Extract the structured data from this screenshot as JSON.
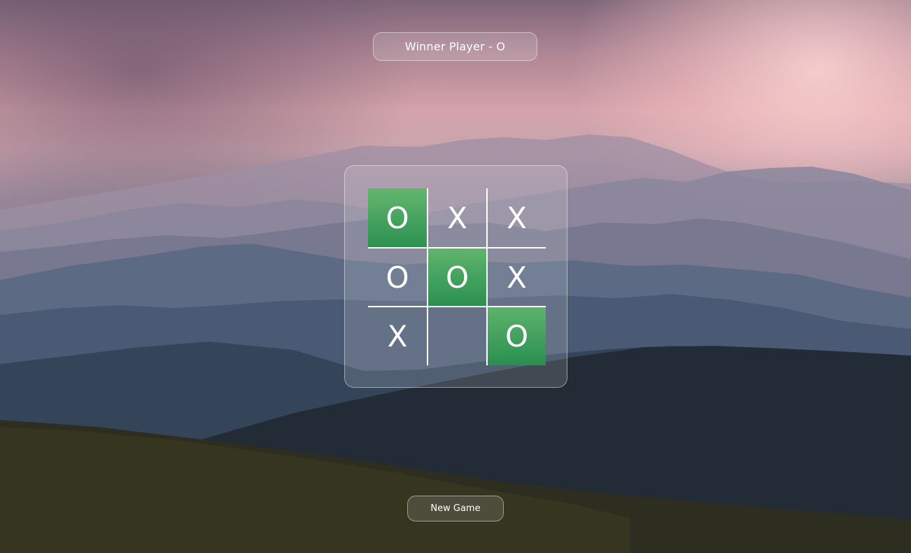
{
  "status": {
    "text": "Winner Player - O"
  },
  "board": {
    "cells": [
      {
        "mark": "O",
        "win": true
      },
      {
        "mark": "X",
        "win": false
      },
      {
        "mark": "X",
        "win": false
      },
      {
        "mark": "O",
        "win": false
      },
      {
        "mark": "O",
        "win": true
      },
      {
        "mark": "X",
        "win": false
      },
      {
        "mark": "X",
        "win": false
      },
      {
        "mark": "",
        "win": false
      },
      {
        "mark": "O",
        "win": true
      }
    ]
  },
  "controls": {
    "new_game_label": "New Game"
  },
  "colors": {
    "win_highlight": "#3fa865",
    "text": "#ffffff",
    "glass_border": "rgba(255,255,255,0.45)"
  }
}
